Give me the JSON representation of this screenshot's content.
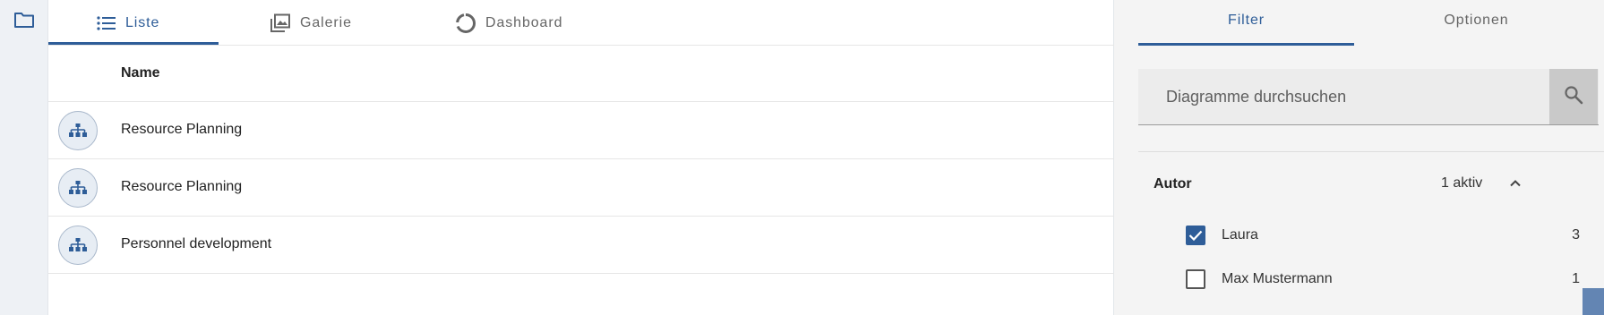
{
  "colors": {
    "accent": "#2e5d98",
    "rail_bg": "#eef1f5",
    "panel_bg": "#f4f4f4",
    "checkbox_checked": "#2e5d98"
  },
  "left_rail": {
    "folder_icon": "folder-icon"
  },
  "main": {
    "tabs": [
      {
        "label": "Liste",
        "icon": "list-icon",
        "active": true
      },
      {
        "label": "Galerie",
        "icon": "gallery-icon",
        "active": false
      },
      {
        "label": "Dashboard",
        "icon": "donut-chart-icon",
        "active": false
      }
    ],
    "table": {
      "column_name": "Name",
      "rows": [
        {
          "name": "Resource Planning",
          "icon": "org-chart-icon"
        },
        {
          "name": "Resource Planning",
          "icon": "org-chart-icon"
        },
        {
          "name": "Personnel development",
          "icon": "org-chart-icon"
        }
      ]
    }
  },
  "panel": {
    "tabs": [
      {
        "label": "Filter",
        "active": true
      },
      {
        "label": "Optionen",
        "active": false
      }
    ],
    "search": {
      "placeholder": "Diagramme durchsuchen",
      "value": "",
      "icon": "search-icon"
    },
    "facet": {
      "title": "Autor",
      "active_text": "1 aktiv",
      "expanded": true,
      "options": [
        {
          "label": "Laura",
          "count": "3",
          "checked": true
        },
        {
          "label": "Max Mustermann",
          "count": "1",
          "checked": false
        }
      ]
    }
  }
}
